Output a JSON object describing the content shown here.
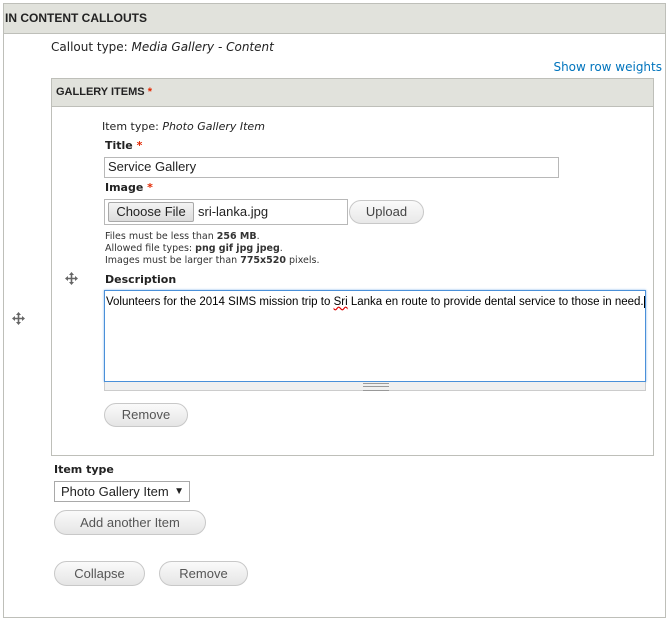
{
  "section": {
    "title": "IN CONTENT CALLOUTS",
    "callout_type_label": "Callout type:",
    "callout_type_value": "Media Gallery - Content",
    "show_row_weights": "Show row weights"
  },
  "gallery": {
    "header": "GALLERY ITEMS",
    "required_mark": "*",
    "item": {
      "item_type_label": "Item type:",
      "item_type_value": "Photo Gallery Item",
      "title_label": "Title",
      "title_value": "Service Gallery",
      "image_label": "Image",
      "choose_file": "Choose File",
      "file_name": "sri-lanka.jpg",
      "upload": "Upload",
      "help_size_prefix": "Files must be less than ",
      "help_size_value": "256 MB",
      "help_types_prefix": "Allowed file types: ",
      "help_types_value": "png gif jpg jpeg",
      "help_dims_prefix": "Images must be larger than ",
      "help_dims_value": "775x520",
      "help_dims_suffix": " pixels.",
      "description_label": "Description",
      "description_before": "Volunteers for the 2014 SIMS mission trip to ",
      "description_misspelled": "Sri",
      "description_after": " Lanka en route to provide dental service to those in need.",
      "remove": "Remove"
    }
  },
  "footer": {
    "item_type_label": "Item type",
    "item_type_selected": "Photo Gallery Item",
    "add_another": "Add another Item",
    "collapse": "Collapse",
    "remove": "Remove"
  },
  "colors": {
    "header_bg": "#e1e2dc",
    "link": "#0074bd",
    "required": "#e32700",
    "focus": "#4a90d9"
  },
  "icons": [
    "drag-handle-icon",
    "dropdown-arrow-icon"
  ]
}
